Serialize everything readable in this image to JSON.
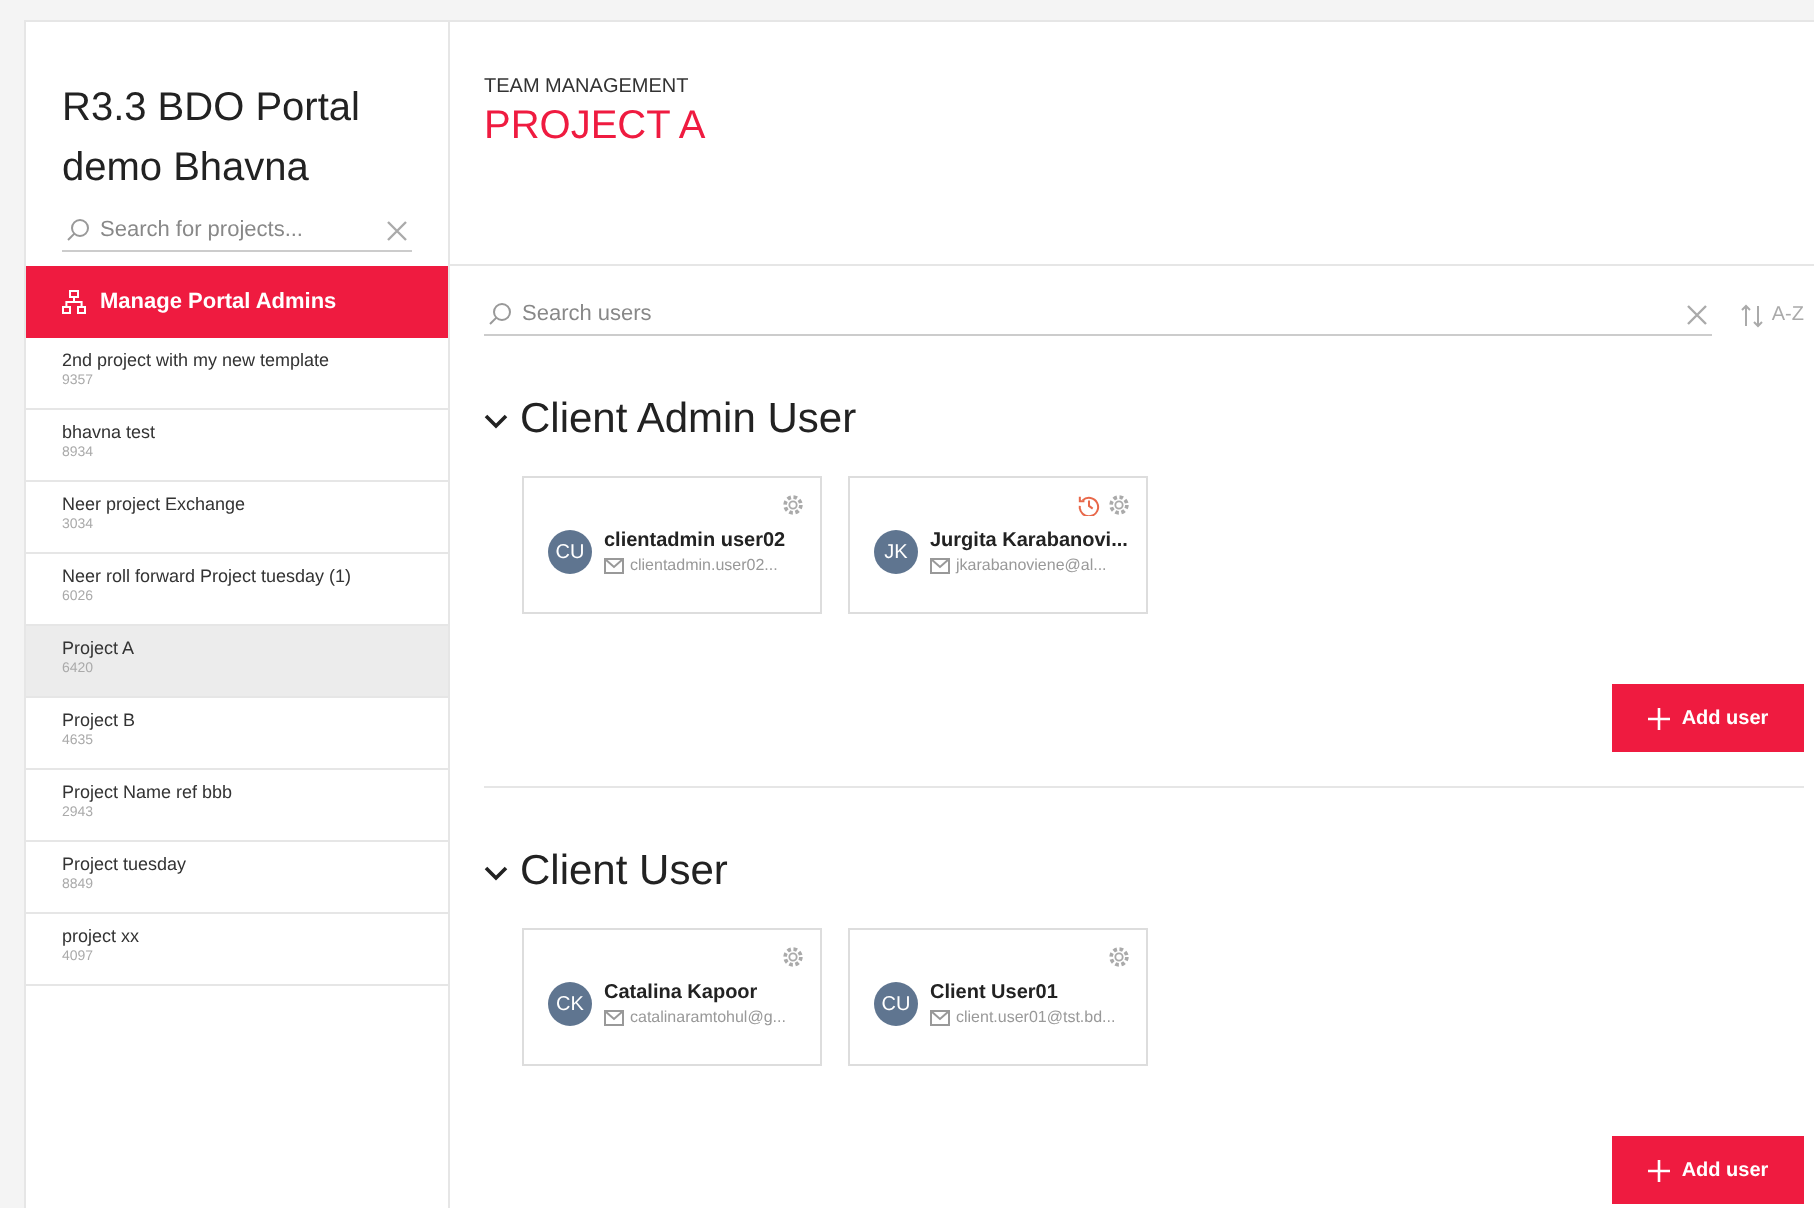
{
  "sidebar": {
    "title": "R3.3 BDO Portal demo Bhavna",
    "search": {
      "placeholder": "Search for projects..."
    },
    "admin_button": "Manage Portal Admins",
    "projects": [
      {
        "name": "2nd project with my new template",
        "code": "9357",
        "selected": false
      },
      {
        "name": "bhavna test",
        "code": "8934",
        "selected": false
      },
      {
        "name": "Neer project Exchange",
        "code": "3034",
        "selected": false
      },
      {
        "name": "Neer roll forward Project tuesday (1)",
        "code": "6026",
        "selected": false
      },
      {
        "name": "Project A",
        "code": "6420",
        "selected": true
      },
      {
        "name": "Project B",
        "code": "4635",
        "selected": false
      },
      {
        "name": "Project Name ref bbb",
        "code": "2943",
        "selected": false
      },
      {
        "name": "Project tuesday",
        "code": "8849",
        "selected": false
      },
      {
        "name": "project xx",
        "code": "4097",
        "selected": false
      }
    ]
  },
  "header": {
    "breadcrumb": "TEAM MANAGEMENT",
    "title": "PROJECT A"
  },
  "user_search": {
    "placeholder": "Search users"
  },
  "sort": "A-Z",
  "sections": [
    {
      "title": "Client Admin User",
      "expanded": true,
      "add_button": "Add user",
      "users": [
        {
          "initials": "CU",
          "name": "clientadmin user02",
          "email": "clientadmin.user02...",
          "history": false
        },
        {
          "initials": "JK",
          "name": "Jurgita Karabanovi...",
          "email": "jkarabanoviene@al...",
          "history": true
        }
      ]
    },
    {
      "title": "Client User",
      "expanded": true,
      "add_button": "Add user",
      "users": [
        {
          "initials": "CK",
          "name": "Catalina Kapoor",
          "email": "catalinaramtohul@g...",
          "history": false
        },
        {
          "initials": "CU",
          "name": "Client User01",
          "email": "client.user01@tst.bd...",
          "history": false
        }
      ]
    }
  ]
}
